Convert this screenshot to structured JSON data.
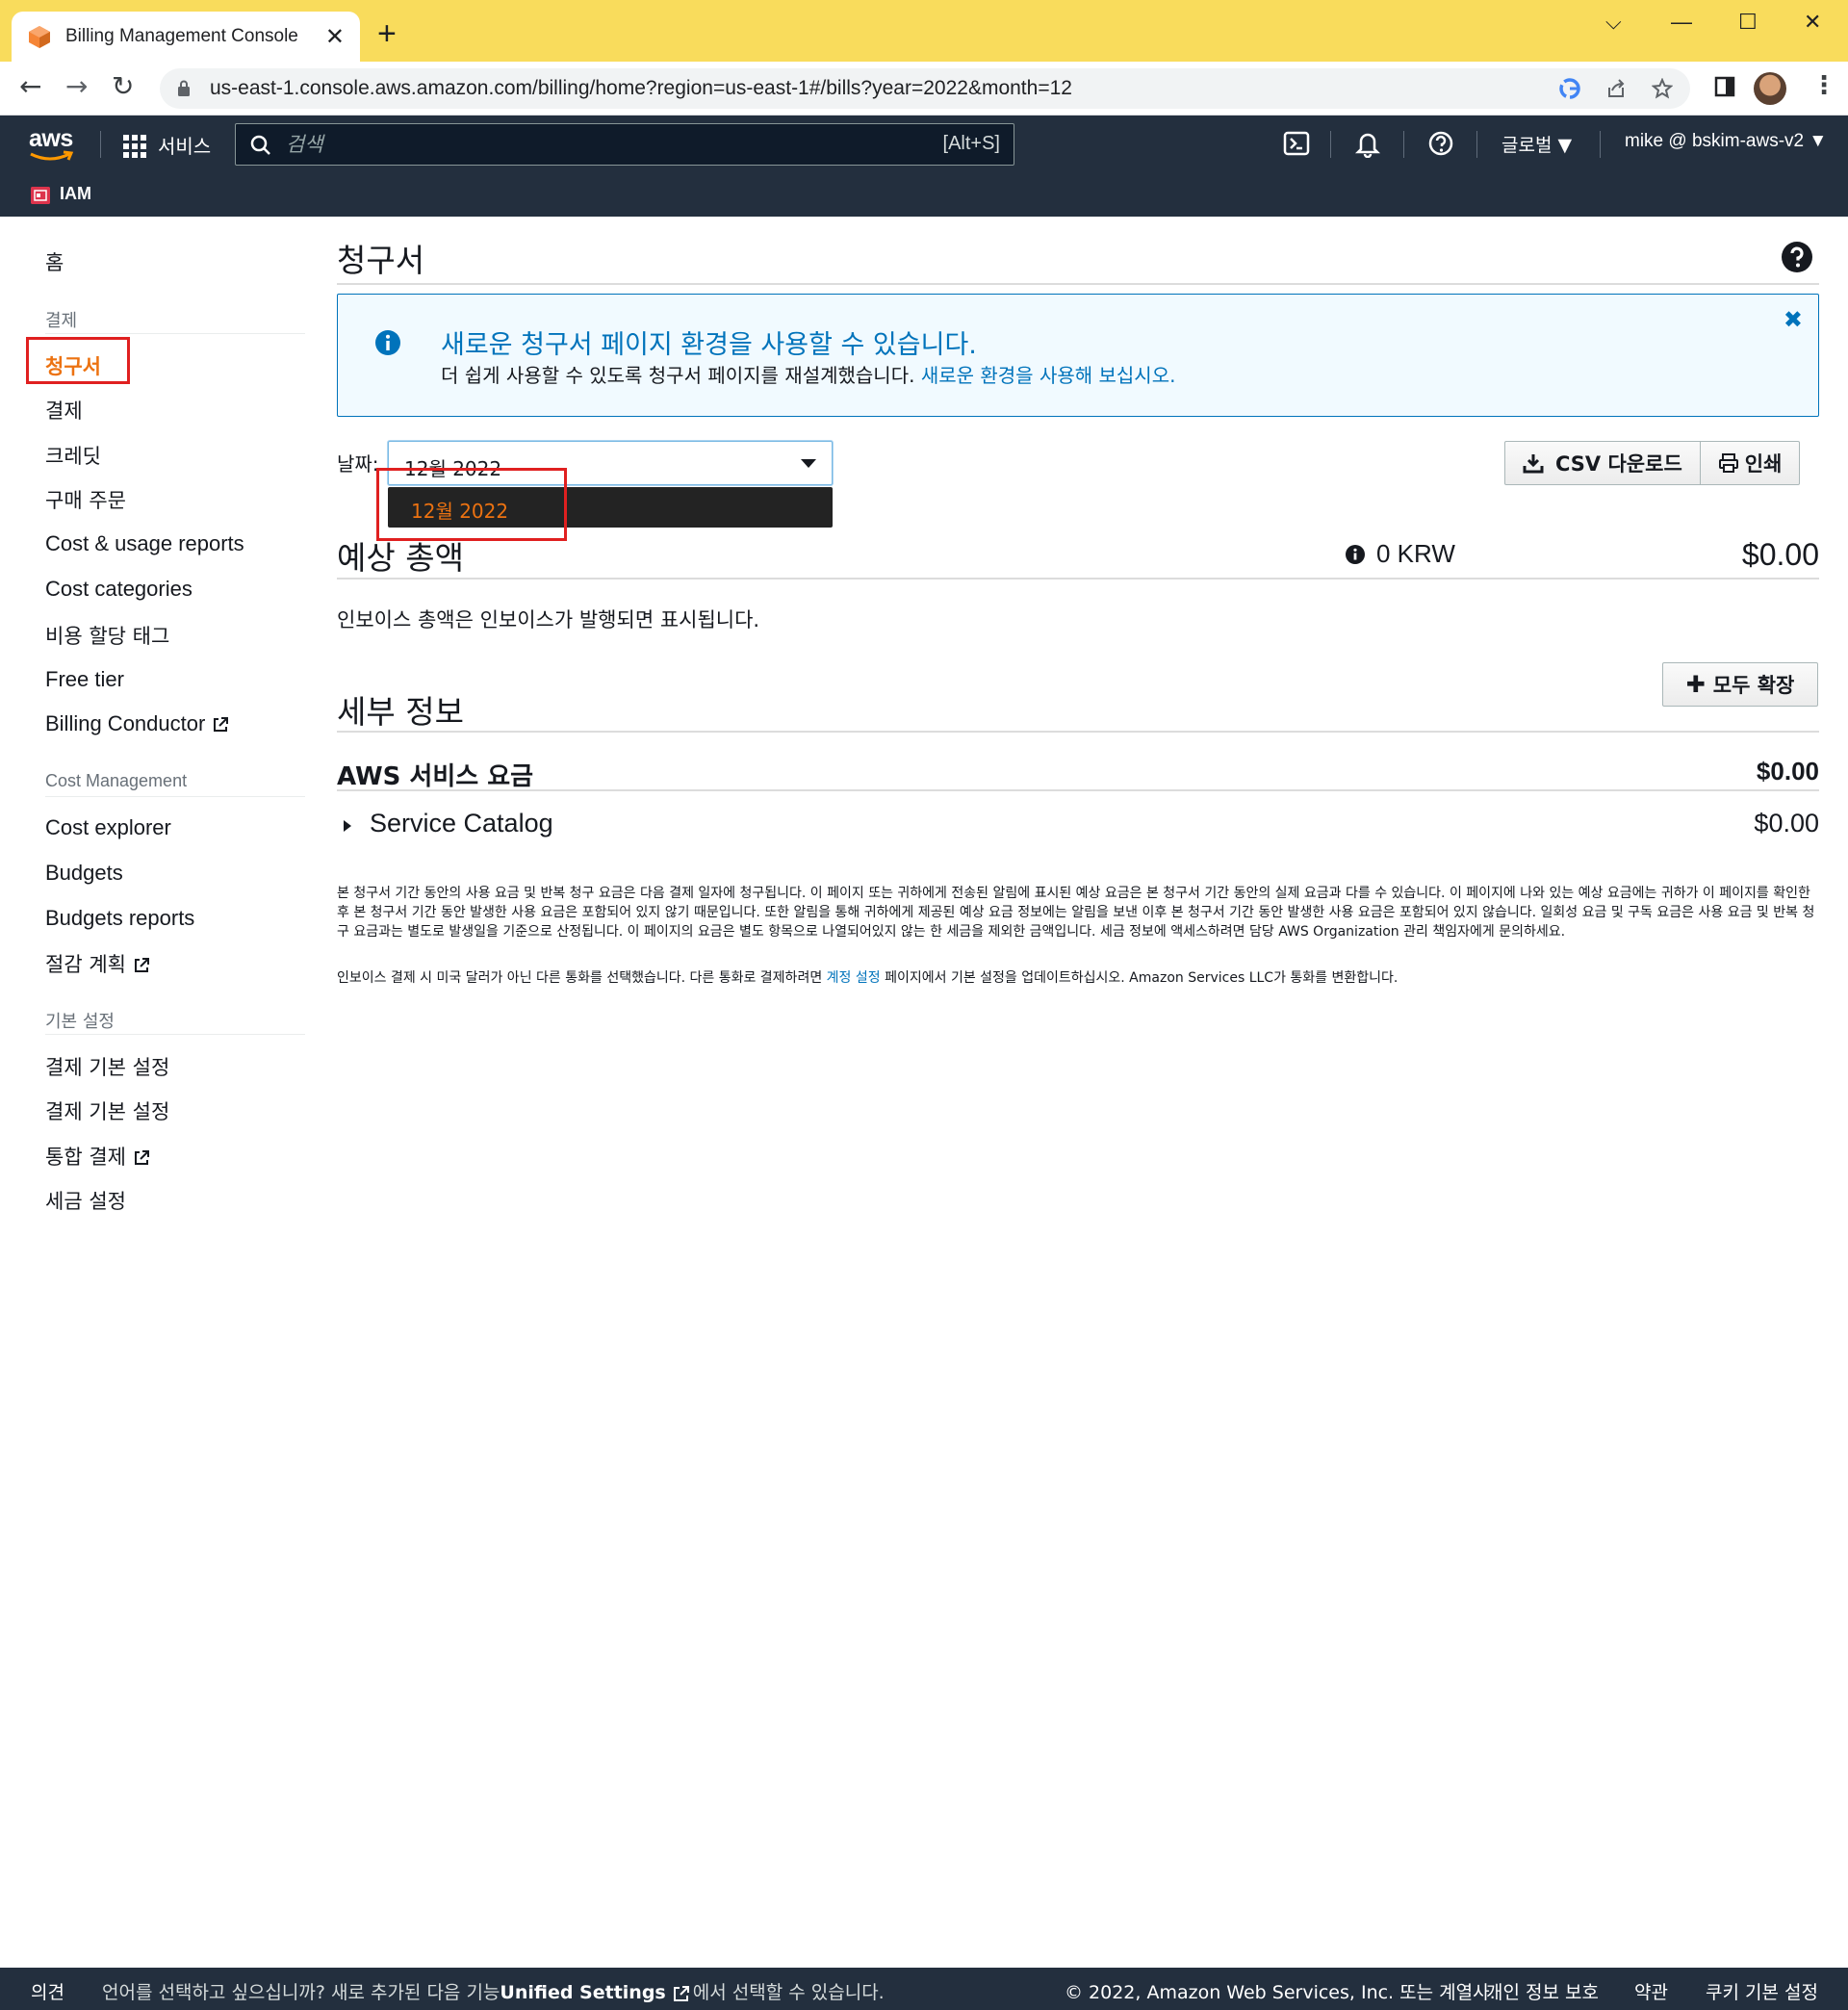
{
  "browser": {
    "tab_title": "Billing Management Console",
    "url": "us-east-1.console.aws.amazon.com/billing/home?region=us-east-1#/bills?year=2022&month=12"
  },
  "aws_nav": {
    "logo": "aws",
    "services_label": "서비스",
    "search_placeholder": "검색",
    "search_shortcut": "[Alt+S]",
    "region_label": "글로벌 ▼",
    "account_label": "mike @ bskim-aws-v2 ▼",
    "favorite_service": "IAM"
  },
  "sidebar": {
    "home": "홈",
    "billing_section": "결제",
    "billing_items": [
      "청구서",
      "결제",
      "크레딧",
      "구매 주문",
      "Cost & usage reports",
      "Cost categories",
      "비용 할당 태그",
      "Free tier",
      "Billing Conductor"
    ],
    "cost_section": "Cost Management",
    "cost_items": [
      "Cost explorer",
      "Budgets",
      "Budgets reports",
      "절감 계획"
    ],
    "pref_section": "기본 설정",
    "pref_items": [
      "결제 기본 설정",
      "결제 기본 설정",
      "통합 결제",
      "세금 설정"
    ]
  },
  "main": {
    "page_title": "청구서",
    "banner": {
      "title": "새로운 청구서 페이지 환경을 사용할 수 있습니다.",
      "text": "더 쉽게 사용할 수 있도록 청구서 페이지를 재설계했습니다. ",
      "link": "새로운 환경을 사용해 보십시오."
    },
    "date_label": "날짜:",
    "date_value": "12월 2022",
    "date_option": "12월 2022",
    "csv_button": "CSV 다운로드",
    "print_button": "인쇄",
    "total_title": "예상 총액",
    "total_krw": "0 KRW",
    "total_usd": "$0.00",
    "invoice_note": "인보이스 총액은 인보이스가 발행되면 표시됩니다.",
    "expand_all": "모두 확장",
    "detail_title": "세부 정보",
    "service_charges_title": "AWS 서비스 요금",
    "service_charges_amount": "$0.00",
    "service_catalog_name": "Service Catalog",
    "service_catalog_amount": "$0.00",
    "fine_print_1": "본 청구서 기간 동안의 사용 요금 및 반복 청구 요금은 다음 결제 일자에 청구됩니다. 이 페이지 또는 귀하에게 전송된 알림에 표시된 예상 요금은 본 청구서 기간 동안의 실제 요금과 다를 수 있습니다. 이 페이지에 나와 있는 예상 요금에는 귀하가 이 페이지를 확인한 후 본 청구서 기간 동안 발생한 사용 요금은 포함되어 있지 않기 때문입니다. 또한 알림을 통해 귀하에게 제공된 예상 요금 정보에는 알림을 보낸 이후 본 청구서 기간 동안 발생한 사용 요금은 포함되어 있지 않습니다. 일회성 요금 및 구독 요금은 사용 요금 및 반복 청구 요금과는 별도로 발생일을 기준으로 산정됩니다. 이 페이지의 요금은 별도 항목으로 나열되어있지 않는 한 세금을 제외한 금액입니다. 세금 정보에 액세스하려면 담당 AWS Organization 관리 책임자에게 문의하세요.",
    "fine_print_2a": "인보이스 결제 시 미국 달러가 아닌 다른 통화를 선택했습니다. 다른 통화로 결제하려면 ",
    "fine_print_2_link": "계정 설정",
    "fine_print_2b": " 페이지에서 기본 설정을 업데이트하십시오. Amazon Services LLC가 통화를 변환합니다."
  },
  "footer": {
    "feedback": "의견",
    "language_prompt_a": "언어를 선택하고 싶으십니까? 새로 추가된 다음 기능",
    "language_prompt_strong": "Unified Settings",
    "language_prompt_b": "에서 선택할 수 있습니다.",
    "copyright": "© 2022, Amazon Web Services, Inc. 또는 계열사.",
    "privacy": "개인 정보 보호",
    "terms": "약관",
    "cookie": "쿠키 기본 설정"
  },
  "colors": {
    "aws_nav_bg": "#232f3e",
    "active_orange": "#ec7211",
    "link_blue": "#0073bb",
    "tab_strip": "#f9dc5c",
    "highlight_red": "#e02020"
  }
}
